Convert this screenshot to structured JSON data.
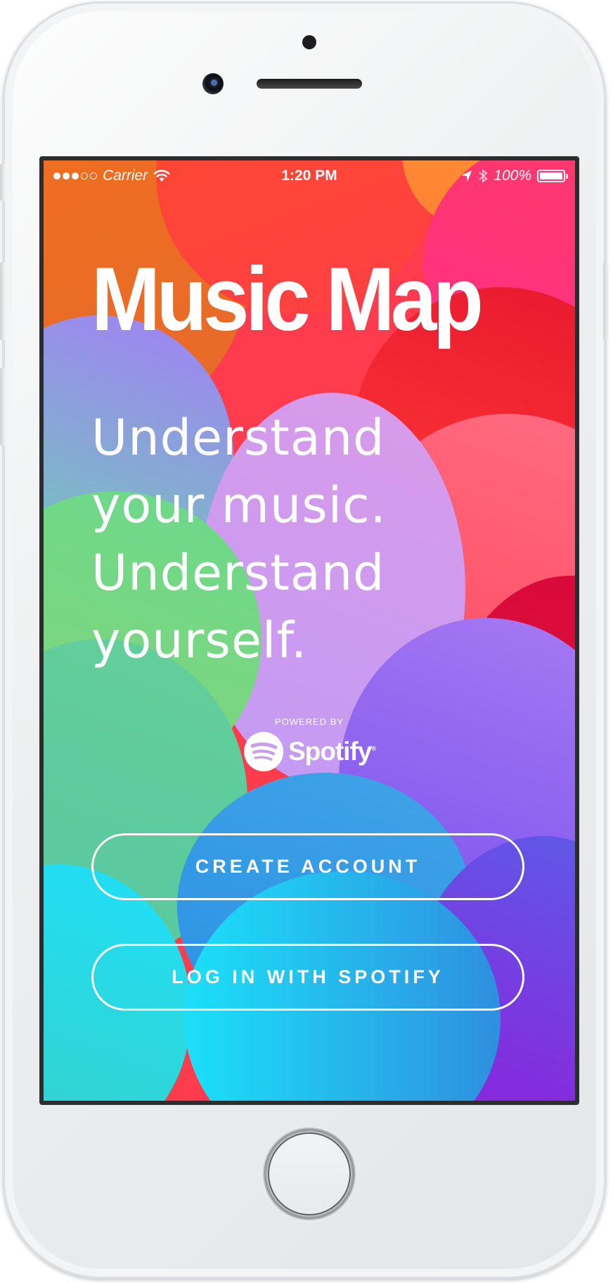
{
  "status_bar": {
    "carrier": "Carrier",
    "time": "1:20 PM",
    "battery": "100%",
    "signal_bars_filled": 3,
    "signal_bars_total": 5,
    "icons": [
      "wifi-icon",
      "location-arrow-icon",
      "bluetooth-icon",
      "battery-icon"
    ]
  },
  "app": {
    "title": "Music Map",
    "tagline": [
      "Understand",
      "your music.",
      "Understand",
      "yourself."
    ]
  },
  "powered_by": {
    "label": "POWERED BY",
    "brand": "Spotify"
  },
  "actions": {
    "create_account": "CREATE ACCOUNT",
    "login_spotify": "LOG IN WITH SPOTIFY"
  },
  "colors": {
    "text": "#ffffff",
    "orange": "#f07a1d",
    "red": "#ff3b3b",
    "pink": "#ff2d7a",
    "purple": "#b58cff",
    "green": "#6bd58b",
    "teal": "#43c7a8",
    "cyan": "#1fd7f5",
    "blue": "#2f8fe8",
    "violet": "#7b4cf0",
    "crimson": "#e1173c"
  }
}
